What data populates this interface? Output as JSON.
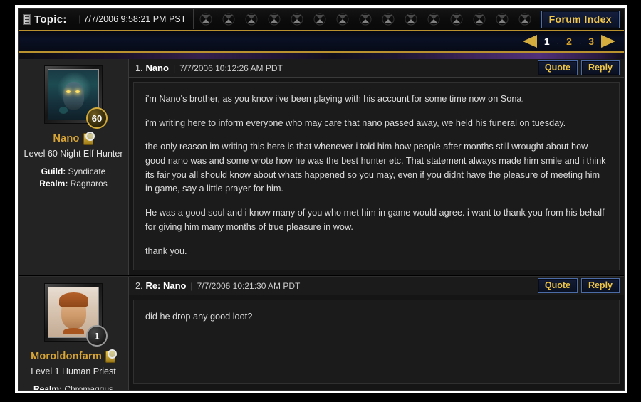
{
  "header": {
    "topic_label": "Topic:",
    "topic_date": "| 7/7/2006 9:58:21 PM PST",
    "forum_index_label": "Forum Index",
    "deco_icon_count": 18
  },
  "pager": {
    "pages": [
      {
        "label": "1",
        "current": true
      },
      {
        "label": "2",
        "current": false
      },
      {
        "label": "3",
        "current": false
      }
    ],
    "separator": "."
  },
  "posts": [
    {
      "number": "1.",
      "author": "Nano",
      "separator": "|",
      "timestamp": "7/7/2006 10:12:26 AM PDT",
      "quote_label": "Quote",
      "reply_label": "Reply",
      "character": {
        "name": "Nano",
        "level_badge": "60",
        "description": "Level 60 Night Elf Hunter",
        "guild_label": "Guild:",
        "guild_value": "Syndicate",
        "realm_label": "Realm:",
        "realm_value": "Ragnaros"
      },
      "paragraphs": [
        "i'm Nano's brother, as you know i've been playing with his account for some time now on Sona.",
        "i'm writing here to inform everyone who may care that nano passed away, we held his funeral on tuesday.",
        "the only reason im writing this here is that whenever i told him how people after months still wrought about how good nano was and some wrote how he was the best hunter etc. That statement always made him smile and i think its fair you all should know about whats happened so you may, even if you didnt have the pleasure of meeting him in game, say a little prayer for him.",
        "He was a good soul and i know many of you who met him in game would agree. i want to thank you from his behalf for giving him many months of true pleasure in wow.",
        "thank you."
      ]
    },
    {
      "number": "2.",
      "author": "Re: Nano",
      "separator": "|",
      "timestamp": "7/7/2006 10:21:30 AM PDT",
      "quote_label": "Quote",
      "reply_label": "Reply",
      "character": {
        "name": "Moroldonfarm",
        "level_badge": "1",
        "description": "Level 1 Human Priest",
        "guild_label": "",
        "guild_value": "",
        "realm_label": "Realm:",
        "realm_value": "Chromaggus"
      },
      "paragraphs": [
        "did he drop any good loot?"
      ]
    }
  ],
  "colors": {
    "gold": "#d4a02c",
    "button_text": "#f0c646",
    "frame": "#ffffff",
    "background": "#000000"
  }
}
